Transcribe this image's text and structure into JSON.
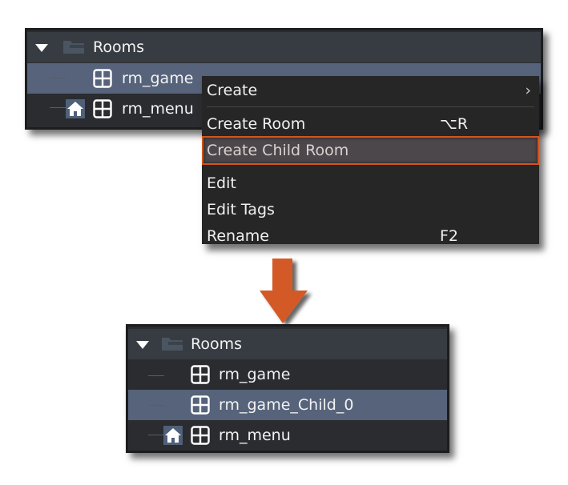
{
  "top_panel": {
    "folder": {
      "label": "Rooms",
      "icon": "folder-icon",
      "expanded": true
    },
    "items": [
      {
        "label": "rm_game",
        "icon": "room-icon",
        "selected": true,
        "home": false
      },
      {
        "label": "rm_menu",
        "icon": "room-icon",
        "selected": false,
        "home": true
      }
    ]
  },
  "context_menu": {
    "items": [
      {
        "label": "Create",
        "shortcut": "",
        "submenu": true
      },
      {
        "label": "Create Room",
        "shortcut": "⌥R",
        "submenu": false
      },
      {
        "label": "Create Child Room",
        "shortcut": "",
        "submenu": false,
        "highlighted": true
      },
      {
        "label": "Edit",
        "shortcut": ""
      },
      {
        "label": "Edit Tags",
        "shortcut": ""
      },
      {
        "label": "Rename",
        "shortcut": "F2"
      }
    ],
    "submenu_glyph": "›"
  },
  "arrow": {
    "icon": "down-arrow-icon",
    "color": "#d35a25"
  },
  "bottom_panel": {
    "folder": {
      "label": "Rooms",
      "icon": "folder-icon",
      "expanded": true
    },
    "items": [
      {
        "label": "rm_game",
        "icon": "room-icon",
        "selected": false,
        "home": false
      },
      {
        "label": "rm_game_Child_0",
        "icon": "room-icon",
        "selected": true,
        "home": false
      },
      {
        "label": "rm_menu",
        "icon": "room-icon",
        "selected": false,
        "home": true
      }
    ]
  },
  "colors": {
    "selection": "#56637b",
    "highlight_border": "#d4541c",
    "menu_bg": "#262626",
    "panel_header": "#373c42"
  }
}
